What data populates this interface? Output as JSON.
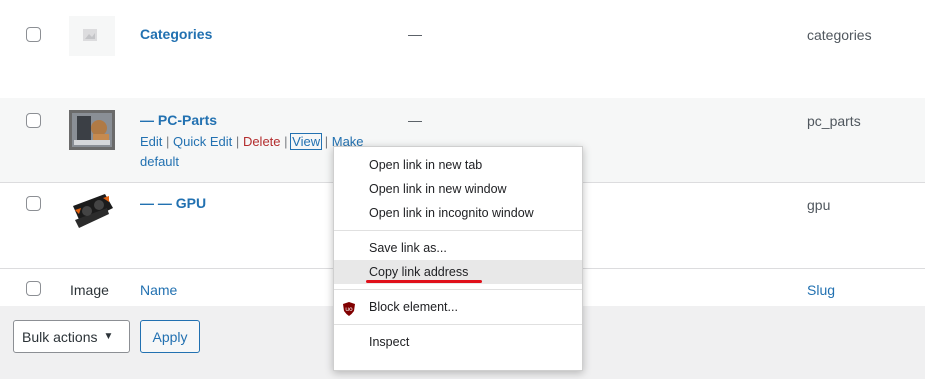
{
  "rows": [
    {
      "name": "Categories",
      "description": "—",
      "slug": "categories",
      "thumb": "placeholder-image-icon"
    },
    {
      "name": "— PC-Parts",
      "description": "—",
      "slug": "pc_parts",
      "thumb": "pc-parts-photo",
      "actions": {
        "edit": "Edit",
        "quick_edit": "Quick Edit",
        "delete": "Delete",
        "view": "View",
        "make_default_1": "Make",
        "make_default_2": "default",
        "sep": "|"
      }
    },
    {
      "name": "— — GPU",
      "description": "—",
      "slug": "gpu",
      "thumb": "gpu-photo"
    }
  ],
  "footer": {
    "image": "Image",
    "name": "Name",
    "slug": "Slug"
  },
  "bulk_actions": {
    "label": "Bulk actions",
    "apply": "Apply"
  },
  "context_menu": {
    "items": [
      "Open link in new tab",
      "Open link in new window",
      "Open link in incognito window",
      "Save link as...",
      "Copy link address",
      "Block element...",
      "Inspect"
    ],
    "highlighted": "Copy link address"
  },
  "colors": {
    "link": "#2271b1",
    "delete": "#b32d2e",
    "underline": "#e0101a",
    "ublock": "#800000"
  }
}
